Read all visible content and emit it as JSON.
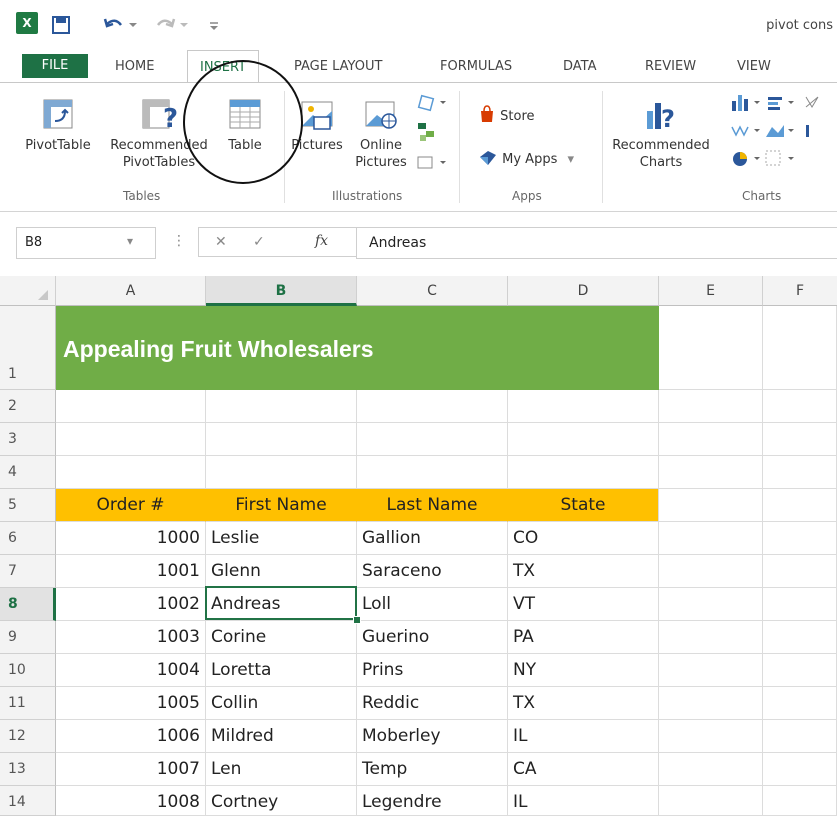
{
  "app": {
    "title": "pivot cons",
    "logo_text": "X"
  },
  "tabs": [
    "FILE",
    "HOME",
    "INSERT",
    "PAGE LAYOUT",
    "FORMULAS",
    "DATA",
    "REVIEW",
    "VIEW"
  ],
  "ribbon": {
    "pivottable": "PivotTable",
    "recommended_pivottables": "Recommended",
    "recommended_pivottables_2": "PivotTables",
    "table": "Table",
    "pictures": "Pictures",
    "online_pictures": "Online",
    "online_pictures_2": "Pictures",
    "store": "Store",
    "my_apps": "My Apps",
    "recommended_charts": "Recommended",
    "recommended_charts_2": "Charts",
    "groups": {
      "tables": "Tables",
      "illustrations": "Illustrations",
      "apps": "Apps",
      "charts": "Charts"
    }
  },
  "formula_bar": {
    "name_box": "B8",
    "fx": "fx",
    "value": "Andreas"
  },
  "columns": [
    "A",
    "B",
    "C",
    "D",
    "E",
    "F"
  ],
  "rows": [
    "1",
    "2",
    "3",
    "4",
    "5",
    "6",
    "7",
    "8",
    "9",
    "10",
    "11",
    "12",
    "13",
    "14"
  ],
  "sheet": {
    "title": "Appealing Fruit Wholesalers",
    "headers": [
      "Order #",
      "First Name",
      "Last Name",
      "State"
    ],
    "data": [
      [
        "1000",
        "Leslie",
        "Gallion",
        "CO"
      ],
      [
        "1001",
        "Glenn",
        "Saraceno",
        "TX"
      ],
      [
        "1002",
        "Andreas",
        "Loll",
        "VT"
      ],
      [
        "1003",
        "Corine",
        "Guerino",
        "PA"
      ],
      [
        "1004",
        "Loretta",
        "Prins",
        "NY"
      ],
      [
        "1005",
        "Collin",
        "Reddic",
        "TX"
      ],
      [
        "1006",
        "Mildred",
        "Moberley",
        "IL"
      ],
      [
        "1007",
        "Len",
        "Temp",
        "CA"
      ],
      [
        "1008",
        "Cortney",
        "Legendre",
        "IL"
      ]
    ]
  },
  "colors": {
    "excel_green": "#1e7145",
    "banner_green": "#70ad47",
    "header_orange": "#ffc000"
  }
}
